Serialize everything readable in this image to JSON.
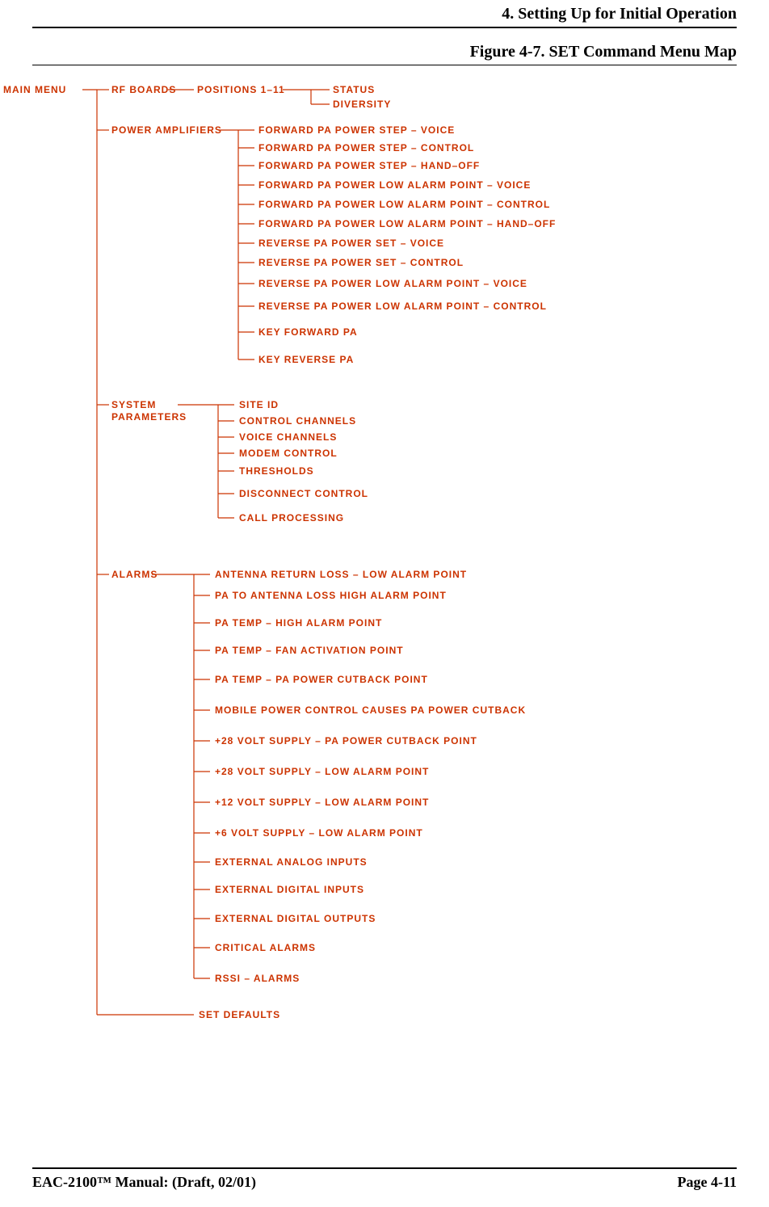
{
  "header": "4. Setting Up for Initial Operation",
  "figure_title": "Figure 4-7. SET Command Menu Map",
  "footer_left": "EAC-2100™ Manual: (Draft, 02/01)",
  "footer_right": "Page 4-11",
  "root": "MAIN  MENU",
  "branches": {
    "rf_boards": {
      "label": "RF  BOARDS",
      "sub_label": "POSITIONS  1–11",
      "children": [
        "STATUS",
        "DIVERSITY"
      ]
    },
    "power_amplifiers": {
      "label": "POWER  AMPLIFIERS",
      "children": [
        "FORWARD  PA  POWER  STEP  –  VOICE",
        "FORWARD  PA  POWER  STEP  –  CONTROL",
        "FORWARD  PA  POWER  STEP  –  HAND–OFF",
        "FORWARD  PA  POWER  LOW  ALARM  POINT  –  VOICE",
        "FORWARD  PA  POWER  LOW  ALARM  POINT  –   CONTROL",
        "FORWARD  PA  POWER  LOW  ALARM  POINT  –  HAND–OFF",
        "REVERSE  PA  POWER  SET  –  VOICE",
        "REVERSE  PA  POWER  SET  –  CONTROL",
        "REVERSE  PA  POWER  LOW  ALARM  POINT  –  VOICE",
        "REVERSE  PA  POWER  LOW  ALARM  POINT  –  CONTROL",
        "KEY  FORWARD  PA",
        "KEY  REVERSE  PA"
      ]
    },
    "system_parameters": {
      "label_line1": "SYSTEM",
      "label_line2": "PARAMETERS",
      "children": [
        "SITE  ID",
        "CONTROL  CHANNELS",
        "VOICE  CHANNELS",
        "MODEM  CONTROL",
        "THRESHOLDS",
        "DISCONNECT  CONTROL",
        "CALL  PROCESSING"
      ]
    },
    "alarms": {
      "label": "ALARMS",
      "children": [
        "ANTENNA  RETURN  LOSS  –  LOW  ALARM  POINT",
        "PA  TO  ANTENNA  LOSS  HIGH  ALARM  POINT",
        "PA  TEMP  –   HIGH  ALARM  POINT",
        "PA  TEMP  –  FAN  ACTIVATION  POINT",
        "PA  TEMP  –  PA  POWER  CUTBACK  POINT",
        "MOBILE  POWER  CONTROL  CAUSES  PA  POWER  CUTBACK",
        "+28  VOLT  SUPPLY  –  PA  POWER  CUTBACK  POINT",
        "+28  VOLT  SUPPLY  –  LOW  ALARM  POINT",
        "+12  VOLT  SUPPLY  –  LOW  ALARM  POINT",
        "+6  VOLT  SUPPLY  –  LOW  ALARM  POINT",
        "EXTERNAL  ANALOG  INPUTS",
        "EXTERNAL  DIGITAL  INPUTS",
        "EXTERNAL  DIGITAL  OUTPUTS",
        "CRITICAL  ALARMS",
        "RSSI  –  ALARMS"
      ]
    },
    "set_defaults": {
      "label": "SET  DEFAULTS"
    }
  }
}
